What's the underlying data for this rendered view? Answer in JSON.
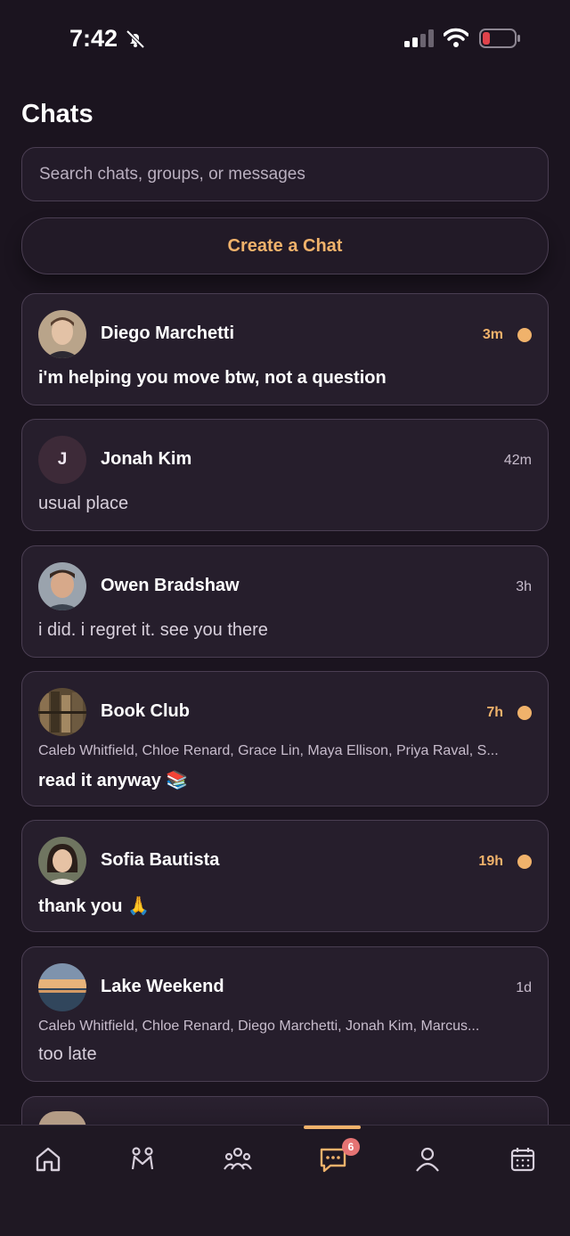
{
  "status": {
    "time": "7:42"
  },
  "header": {
    "title": "Chats"
  },
  "search": {
    "placeholder": "Search chats, groups, or messages"
  },
  "create_button": {
    "label": "Create a Chat"
  },
  "chats": [
    {
      "name": "Diego Marchetti",
      "time": "3m",
      "unread": true,
      "preview": "i'm helping you move btw, not a question",
      "avatar": "photo"
    },
    {
      "name": "Jonah Kim",
      "time": "42m",
      "unread": false,
      "preview": "usual place",
      "avatar_initial": "J"
    },
    {
      "name": "Owen Bradshaw",
      "time": "3h",
      "unread": false,
      "preview": "i did. i regret it. see you there",
      "avatar": "photo"
    },
    {
      "name": "Book Club",
      "time": "7h",
      "unread": true,
      "members": "Caleb Whitfield, Chloe Renard, Grace Lin, Maya Ellison, Priya Raval, S...",
      "preview": "read it anyway 📚",
      "avatar": "photo"
    },
    {
      "name": "Sofia Bautista",
      "time": "19h",
      "unread": true,
      "preview": "thank you 🙏",
      "avatar": "photo"
    },
    {
      "name": "Lake Weekend",
      "time": "1d",
      "unread": false,
      "members": "Caleb Whitfield, Chloe Renard, Diego Marchetti, Jonah Kim, Marcus...",
      "preview": "too late",
      "avatar": "photo"
    }
  ],
  "tab_bar": {
    "tabs": [
      "home-icon",
      "pair-icon",
      "group-icon",
      "chat-icon",
      "profile-icon",
      "calendar-icon"
    ],
    "active": "chat-icon",
    "chat_badge": "6"
  },
  "colors": {
    "accent": "#f0b26b",
    "background": "#1b141f",
    "card": "#261e2c",
    "badge": "#e57373"
  }
}
